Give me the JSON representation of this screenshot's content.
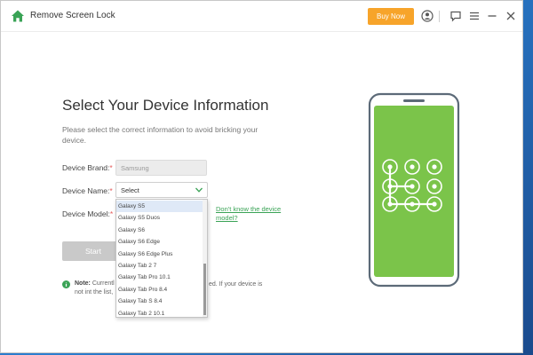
{
  "titlebar": {
    "app_title": "Remove Screen Lock",
    "buy_label": "Buy Now"
  },
  "colors": {
    "accent_green": "#3aa356",
    "buy_orange": "#f7a42a",
    "phone_screen_green": "#7bc44a"
  },
  "icons": [
    "home-icon",
    "account-icon",
    "feedback-icon",
    "menu-icon",
    "minimize-icon",
    "close-icon",
    "chevron-down-icon",
    "info-icon"
  ],
  "main": {
    "title": "Select Your Device Information",
    "subtitle": "Please select the correct information to avoid bricking your device."
  },
  "form": {
    "brand_label": "Device Brand:",
    "brand_value": "Samsung",
    "name_label": "Device Name:",
    "name_value": "Select",
    "model_label": "Device Model:",
    "required_mark": "*",
    "help_link": "Don't know the device model?",
    "start_label": "Start"
  },
  "dropdown": {
    "items": [
      "Galaxy S5",
      "Galaxy S5 Duos",
      "Galaxy S6",
      "Galaxy S6 Edge",
      "Galaxy S6 Edge Plus",
      "Galaxy Tab 2 7",
      "Galaxy Tab Pro 10.1",
      "Galaxy Tab Pro 8.4",
      "Galaxy Tab S 8.4",
      "Galaxy Tab 2 10.1"
    ],
    "selected_index": 0
  },
  "note": {
    "prefix": "Note:",
    "visible_start": "Currentl",
    "visible_end": "ed. If your device is",
    "visible_cont": "not int the list,"
  }
}
